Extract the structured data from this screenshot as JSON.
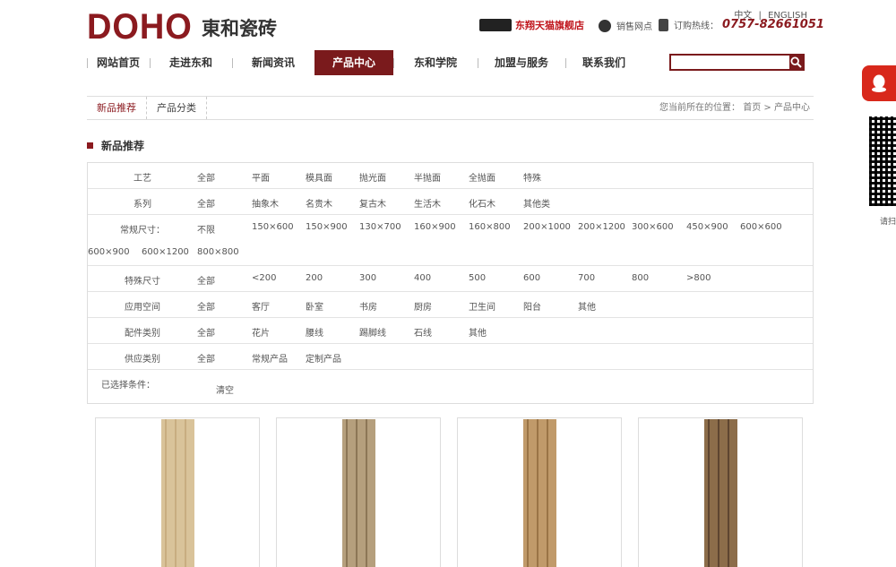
{
  "header": {
    "logo_text": "DOHO",
    "logo_cn": "東和瓷砖",
    "lang_cn": "中文",
    "lang_sep": "|",
    "lang_en": "ENGLISH",
    "tmall_label": "东翔天猫旗舰店",
    "sales_network": "销售网点",
    "hotline_label": "订购热线：",
    "hotline_number": "0757-82661051"
  },
  "nav": {
    "items": [
      "网站首页",
      "走进东和",
      "新闻资讯",
      "产品中心",
      "东和学院",
      "加盟与服务",
      "联系我们"
    ],
    "active_index": 3
  },
  "search": {
    "placeholder": ""
  },
  "subnav": {
    "tabs": [
      "新品推荐",
      "产品分类"
    ],
    "breadcrumb_prefix": "您当前所在的位置：",
    "breadcrumb_home": "首页",
    "breadcrumb_sep": ">",
    "breadcrumb_current": "产品中心"
  },
  "section_title": "新品推荐",
  "filters": {
    "craft": {
      "label": "工艺",
      "options": [
        "全部",
        "平面",
        "模具面",
        "抛光面",
        "半抛面",
        "全抛面",
        "特殊"
      ]
    },
    "series": {
      "label": "系列",
      "options": [
        "全部",
        "抽象木",
        "名贵木",
        "复古木",
        "生活木",
        "化石木",
        "其他类"
      ]
    },
    "size": {
      "label": "常规尺寸：",
      "options": [
        "不限",
        "150×600",
        "150×900",
        "130×700",
        "160×900",
        "160×800",
        "200×1000",
        "200×1200",
        "300×600",
        "450×900",
        "600×600",
        "600×900",
        "600×1200",
        "800×800"
      ]
    },
    "special": {
      "label": "特殊尺寸",
      "options": [
        "全部",
        "<200",
        "200",
        "300",
        "400",
        "500",
        "600",
        "700",
        "800",
        ">800"
      ]
    },
    "space": {
      "label": "应用空间",
      "options": [
        "全部",
        "客厅",
        "卧室",
        "书房",
        "厨房",
        "卫生间",
        "阳台",
        "其他"
      ]
    },
    "parts": {
      "label": "配件类别",
      "options": [
        "全部",
        "花片",
        "腰线",
        "踢脚线",
        "石线",
        "其他"
      ]
    },
    "supply": {
      "label": "供应类别",
      "options": [
        "全部",
        "常规产品",
        "定制产品"
      ]
    },
    "selected": {
      "label": "已选择条件：",
      "clear": "清空"
    }
  },
  "products": [
    {
      "color": "#d9c39a",
      "grain": "#c8ad80"
    },
    {
      "color": "#b59f7d",
      "grain": "#8c7656"
    },
    {
      "color": "#c09a6a",
      "grain": "#9a7446"
    },
    {
      "color": "#8c6d4a",
      "grain": "#5e4530"
    }
  ],
  "colors": {
    "brand": "#8b1a1f",
    "nav_active": "#7a1a1c",
    "qq": "#d8281b"
  },
  "side": {
    "hint": "请扫"
  }
}
